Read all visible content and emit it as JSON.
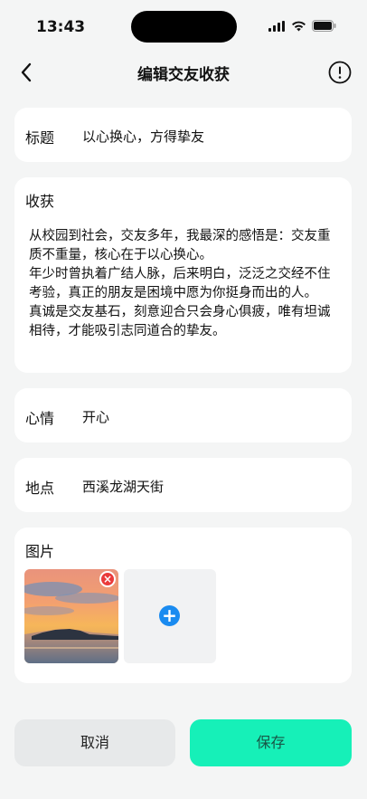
{
  "status": {
    "time": "13:43"
  },
  "header": {
    "title": "编辑交友收获"
  },
  "form": {
    "title_label": "标题",
    "title_value": "以心换心，方得挚友",
    "harvest_label": "收获",
    "harvest_text": "从校园到社会，交友多年，我最深的感悟是：交友重质不重量，核心在于以心换心。\n年少时曾执着广结人脉，后来明白，泛泛之交经不住考验，真正的朋友是困境中愿为你挺身而出的人。\n真诚是交友基石，刻意迎合只会身心俱疲，唯有坦诚相待，才能吸引志同道合的挚友。",
    "mood_label": "心情",
    "mood_value": "开心",
    "location_label": "地点",
    "location_value": "西溪龙湖天街",
    "images_label": "图片"
  },
  "actions": {
    "cancel_label": "取消",
    "save_label": "保存"
  },
  "colors": {
    "save_bg": "#16f0b8",
    "add_icon": "#1a8bf0",
    "remove_icon": "#ea3b3b"
  },
  "icons": [
    "back-arrow-icon",
    "info-icon",
    "signal-icon",
    "wifi-icon",
    "battery-icon",
    "remove-icon",
    "add-icon"
  ]
}
